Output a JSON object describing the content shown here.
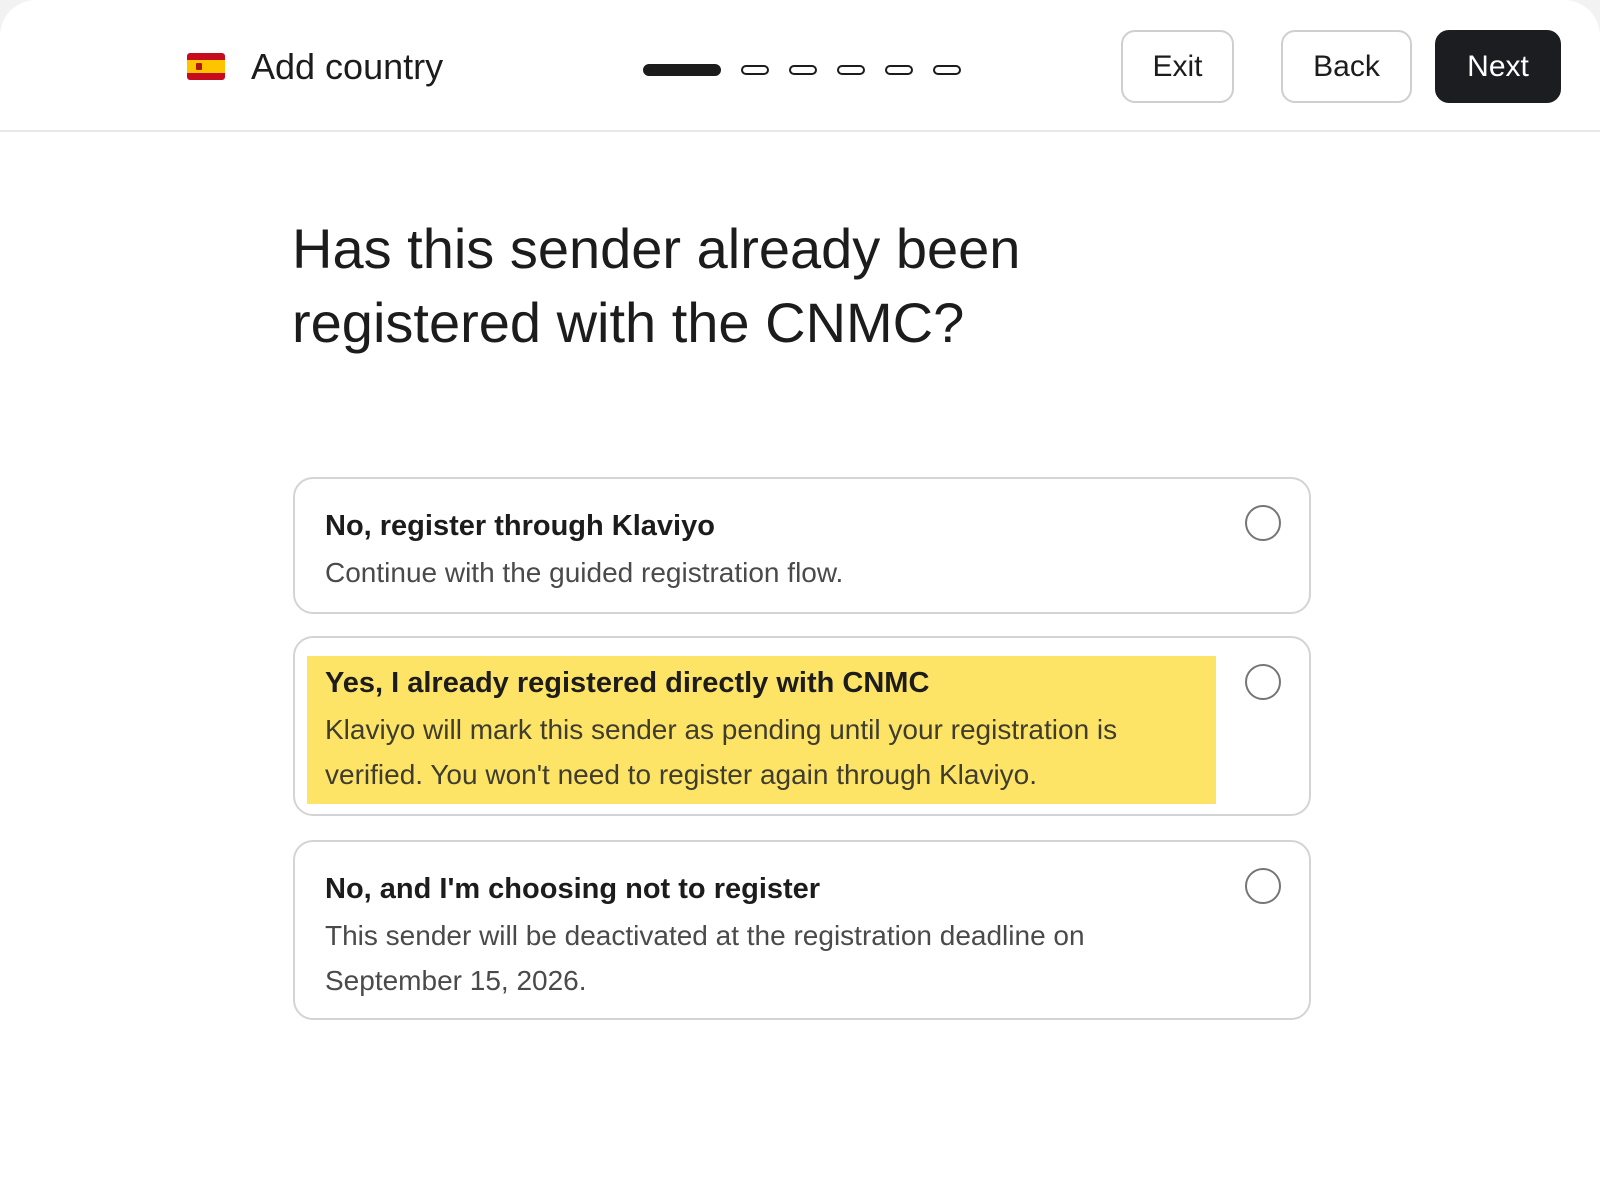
{
  "header": {
    "title": "Add country",
    "flag_icon": "spain-flag-icon",
    "steps": {
      "total": 6,
      "current": 1
    },
    "exit_label": "Exit",
    "back_label": "Back",
    "next_label": "Next"
  },
  "main": {
    "question": "Has this sender already been registered with the CNMC?",
    "options": [
      {
        "title": "No, register through Klaviyo",
        "description": "Continue with the guided registration flow.",
        "selected": false
      },
      {
        "title": "Yes, I already registered directly with CNMC",
        "description": "Klaviyo will mark this sender as pending until your registration is verified. You won't need to register again through Klaviyo.",
        "selected": false,
        "highlighted": true,
        "highlight_color": "#fde466"
      },
      {
        "title": "No, and I'm choosing not to register",
        "description": "This sender will be deactivated at the registration deadline on September 15, 2026.",
        "selected": false
      }
    ]
  },
  "colors": {
    "primary_button": "#1c1d20",
    "border": "#d4d4d4"
  }
}
